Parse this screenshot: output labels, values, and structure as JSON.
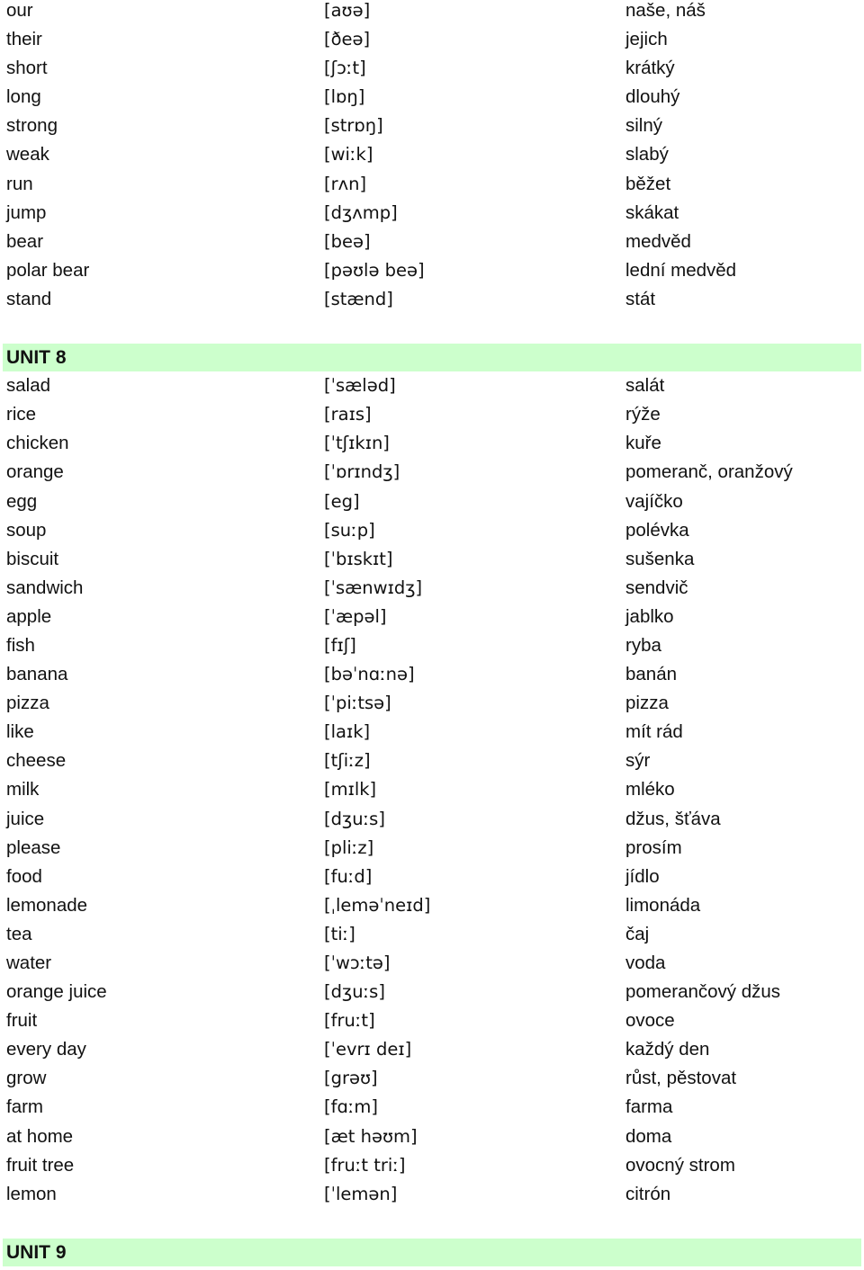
{
  "sections": [
    {
      "title": "",
      "rows": [
        {
          "en": "our",
          "ipa": "[aʊə]",
          "cz": "naše, náš"
        },
        {
          "en": "their",
          "ipa": "[ðeə]",
          "cz": "jejich"
        },
        {
          "en": "short",
          "ipa": "[ʃɔːt]",
          "cz": "krátký"
        },
        {
          "en": "long",
          "ipa": "[lɒŋ]",
          "cz": "dlouhý"
        },
        {
          "en": "strong",
          "ipa": "[strɒŋ]",
          "cz": "silný"
        },
        {
          "en": "weak",
          "ipa": "[wiːk]",
          "cz": "slabý"
        },
        {
          "en": "run",
          "ipa": "[rʌn]",
          "cz": "běžet"
        },
        {
          "en": "jump",
          "ipa": "[dʒʌmp]",
          "cz": "skákat"
        },
        {
          "en": "bear",
          "ipa": "[beə]",
          "cz": "medvěd"
        },
        {
          "en": "polar bear",
          "ipa": "[pəʊlə beə]",
          "cz": "lední medvěd"
        },
        {
          "en": "stand",
          "ipa": "[stænd]",
          "cz": "stát"
        }
      ]
    },
    {
      "title": "UNIT 8",
      "rows": [
        {
          "en": "salad",
          "ipa": "[ˈsæləd]",
          "cz": "salát"
        },
        {
          "en": "rice",
          "ipa": "[raɪs]",
          "cz": "rýže"
        },
        {
          "en": "chicken",
          "ipa": "[ˈtʃɪkɪn]",
          "cz": "kuře"
        },
        {
          "en": "orange",
          "ipa": "[ˈɒrɪndʒ]",
          "cz": "pomeranč, oranžový"
        },
        {
          "en": "egg",
          "ipa": "[eg]",
          "cz": "vajíčko"
        },
        {
          "en": "soup",
          "ipa": "[suːp]",
          "cz": "polévka"
        },
        {
          "en": "biscuit",
          "ipa": "[ˈbɪskɪt]",
          "cz": "sušenka"
        },
        {
          "en": "sandwich",
          "ipa": "[ˈsænwɪdʒ]",
          "cz": "sendvič"
        },
        {
          "en": "apple",
          "ipa": "[ˈæpəl]",
          "cz": "jablko"
        },
        {
          "en": "fish",
          "ipa": "[fɪʃ]",
          "cz": "ryba"
        },
        {
          "en": "banana",
          "ipa": "[bəˈnɑːnə]",
          "cz": "banán"
        },
        {
          "en": "pizza",
          "ipa": "[ˈpiːtsə]",
          "cz": "pizza"
        },
        {
          "en": "like",
          "ipa": "[laɪk]",
          "cz": "mít rád"
        },
        {
          "en": "cheese",
          "ipa": "[tʃiːz]",
          "cz": "sýr"
        },
        {
          "en": "milk",
          "ipa": "[mɪlk]",
          "cz": "mléko"
        },
        {
          "en": "juice",
          "ipa": "[dʒuːs]",
          "cz": "džus, šťáva"
        },
        {
          "en": "please",
          "ipa": "[pliːz]",
          "cz": "prosím"
        },
        {
          "en": "food",
          "ipa": "[fuːd]",
          "cz": "jídlo"
        },
        {
          "en": "lemonade",
          "ipa": "[ˌleməˈneɪd]",
          "cz": "limonáda"
        },
        {
          "en": "tea",
          "ipa": "[tiː]",
          "cz": "čaj"
        },
        {
          "en": "water",
          "ipa": "[ˈwɔːtə]",
          "cz": "voda"
        },
        {
          "en": "orange juice",
          "ipa": "[dʒuːs]",
          "cz": "pomerančový džus"
        },
        {
          "en": "fruit",
          "ipa": "[fruːt]",
          "cz": "ovoce"
        },
        {
          "en": "every day",
          "ipa": "[ˈevrɪ deɪ]",
          "cz": "každý den"
        },
        {
          "en": "grow",
          "ipa": "[grəʊ]",
          "cz": "růst, pěstovat"
        },
        {
          "en": "farm",
          "ipa": "[fɑːm]",
          "cz": "farma"
        },
        {
          "en": "at home",
          "ipa": "[æt həʊm]",
          "cz": "doma"
        },
        {
          "en": "fruit tree",
          "ipa": "[fruːt triː]",
          "cz": "ovocný strom"
        },
        {
          "en": "lemon",
          "ipa": "[ˈlemən]",
          "cz": "citrón"
        }
      ]
    },
    {
      "title": "UNIT 9",
      "rows": []
    }
  ],
  "colors": {
    "unit_header_bg": "#ccffcc",
    "text": "#111111"
  }
}
